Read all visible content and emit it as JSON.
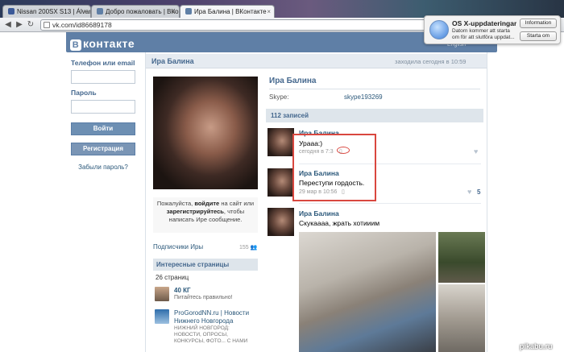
{
  "browser": {
    "tabs": [
      {
        "label": "Nissan 200SX S13 | Álvar"
      },
      {
        "label": "Добро пожаловать | ВКо"
      },
      {
        "label": "Ира Балина | ВКонтакте"
      }
    ],
    "url": "vk.com/id86689178"
  },
  "notification": {
    "title": "OS X-uppdateringar...",
    "text": "Datorn kommer att starta om för att slutföra uppdat...",
    "btn_info": "Information",
    "btn_restart": "Starta om"
  },
  "vk": {
    "logo": "контакте",
    "logo_letter": "В",
    "lang": "English"
  },
  "login": {
    "phone_label": "Телефон или email",
    "password_label": "Пароль",
    "login_button": "Войти",
    "register_button": "Регистрация",
    "forgot": "Забыли пароль?"
  },
  "profile": {
    "name": "Ира Балина",
    "last_seen": "заходила сегодня в 10:59",
    "login_note_1": "Пожалуйста,",
    "login_note_login": "войдите",
    "login_note_2": "на сайт или",
    "login_note_register": "зарегистрируйтесь",
    "login_note_3": ", чтобы написать Ире сообщение.",
    "subscribers_label": "Подписчики Иры",
    "subscribers_count": "155",
    "skype_label": "Skype:",
    "skype_value": "skype193269"
  },
  "interesting": {
    "title": "Интересные страницы",
    "count": "26 страниц",
    "pages": [
      {
        "name": "40 КГ",
        "sub": "Питайтесь правильно!"
      },
      {
        "name": "ProGorodNN.ru | Новости Нижнего Новгорода",
        "sub": "НИЖНИЙ НОВГОРОД: НОВОСТИ, ОПРОСЫ, КОНКУРСЫ, ФОТО... С НАМИ"
      }
    ]
  },
  "wall": {
    "count": "112 записей",
    "posts": [
      {
        "author": "Ира Балина",
        "text": "Урааа:)",
        "date": "сегодня в 7:3"
      },
      {
        "author": "Ира Балина",
        "text": "Переступи гордость.",
        "date": "29 мар в 10:56",
        "likes": "5"
      },
      {
        "author": "Ира Балина",
        "text": "Скукаааа, жрать хотииим"
      }
    ]
  },
  "watermark": "pikabu.ru"
}
